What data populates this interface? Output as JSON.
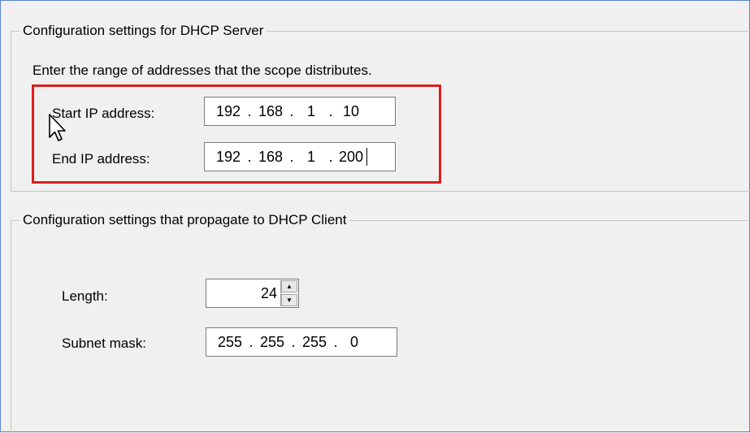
{
  "server_group": {
    "title": "Configuration settings for DHCP Server",
    "instruction": "Enter the range of addresses that the scope distributes.",
    "start_ip": {
      "label": "Start IP address:",
      "octets": [
        "192",
        "168",
        "1",
        "10"
      ]
    },
    "end_ip": {
      "label": "End IP address:",
      "octets": [
        "192",
        "168",
        "1",
        "200"
      ]
    }
  },
  "client_group": {
    "title": "Configuration settings that propagate to DHCP Client",
    "length": {
      "label": "Length:",
      "value": "24"
    },
    "subnet_mask": {
      "label": "Subnet mask:",
      "octets": [
        "255",
        "255",
        "255",
        "0"
      ]
    }
  },
  "colors": {
    "highlight": "#e01c1c",
    "frame_border": "#5a86c9",
    "background": "#f0f0f0"
  }
}
